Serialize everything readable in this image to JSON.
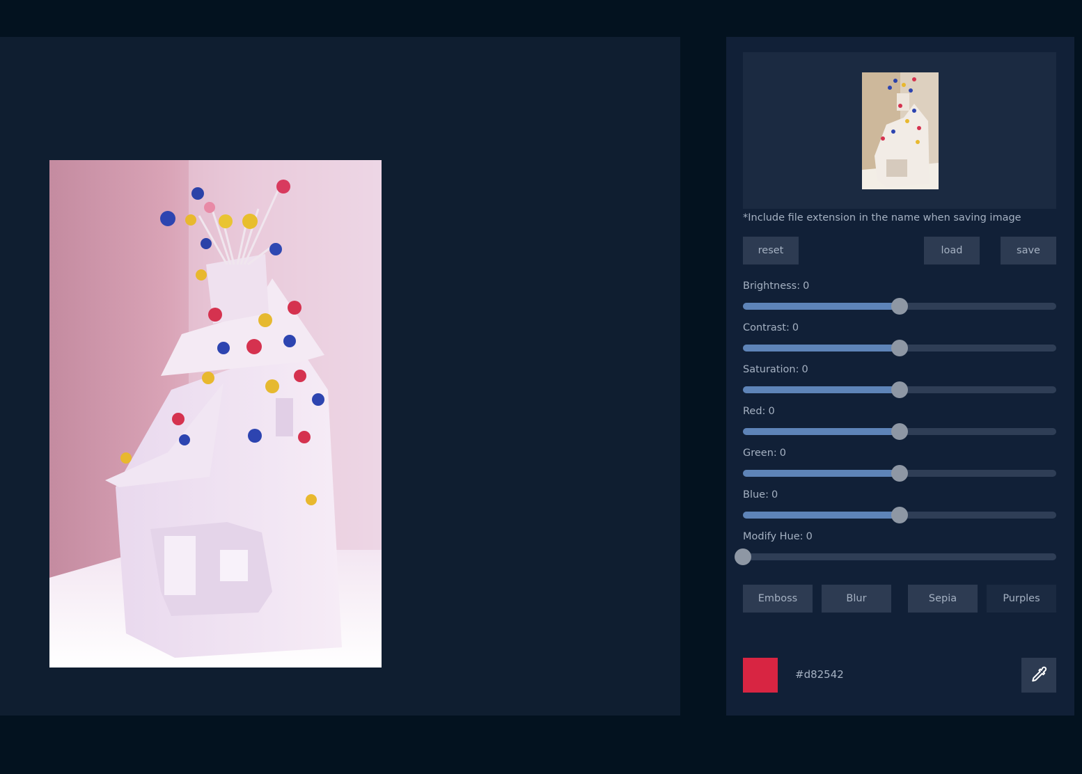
{
  "note": "*Include file extension in the name when saving image",
  "buttons": {
    "reset": "reset",
    "load": "load",
    "save": "save"
  },
  "sliders": [
    {
      "label": "Brightness:",
      "value": "0",
      "fraction": 0.5
    },
    {
      "label": "Contrast:",
      "value": "0",
      "fraction": 0.5
    },
    {
      "label": "Saturation:",
      "value": "0",
      "fraction": 0.5
    },
    {
      "label": "Red:",
      "value": "0",
      "fraction": 0.5
    },
    {
      "label": "Green:",
      "value": "0",
      "fraction": 0.5
    },
    {
      "label": "Blue:",
      "value": "0",
      "fraction": 0.5
    },
    {
      "label": "Modify Hue:",
      "value": "0",
      "fraction": 0.0
    }
  ],
  "filters": [
    "Emboss",
    "Blur",
    "Sepia",
    "Purples"
  ],
  "color": {
    "hex": "#d82542",
    "swatch": "#d82542"
  },
  "icons": {
    "picker": "eyedropper-icon"
  }
}
